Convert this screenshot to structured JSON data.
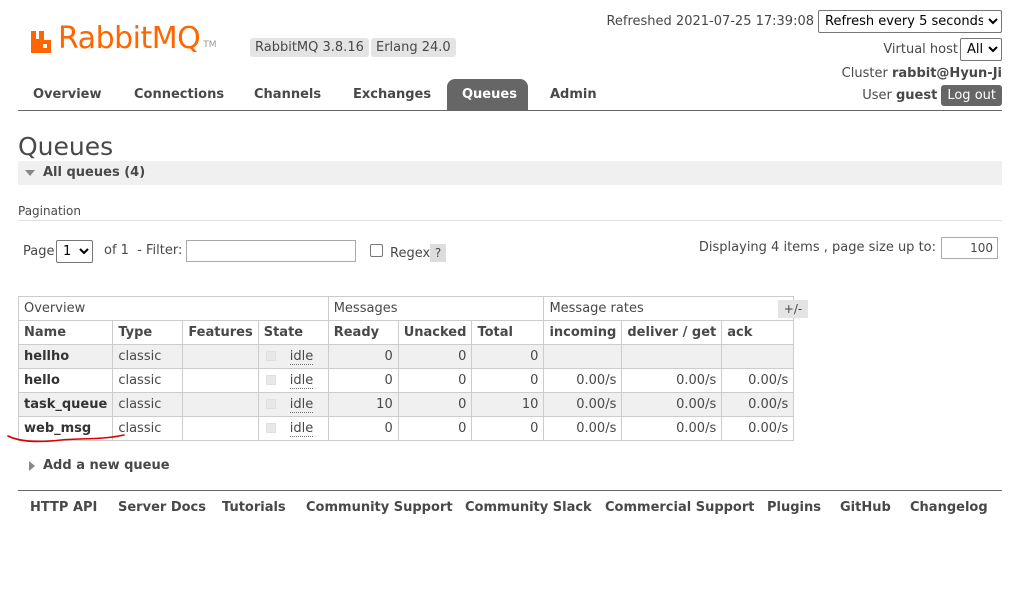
{
  "brand": {
    "logo_text": "RabbitMQ",
    "logo_tm": "TM",
    "rabbitmq_version": "RabbitMQ 3.8.16",
    "erlang_version": "Erlang 24.0",
    "accent_color": "#ff6600"
  },
  "header": {
    "refreshed": "Refreshed 2021-07-25 17:39:08",
    "refresh_option": "Refresh every 5 seconds",
    "vhost_label": "Virtual host",
    "vhost_value": "All",
    "cluster_label": "Cluster",
    "cluster_value": "rabbit@Hyun-Ji",
    "user_label": "User",
    "user_value": "guest",
    "logout": "Log out"
  },
  "nav": {
    "tabs": [
      "Overview",
      "Connections",
      "Channels",
      "Exchanges",
      "Queues",
      "Admin"
    ],
    "active": "Queues"
  },
  "page": {
    "title": "Queues",
    "section": "All queues (4)",
    "pagination_label": "Pagination",
    "page_label": "Page",
    "page_value": "1",
    "of_label": "of 1",
    "filter_label": "- Filter:",
    "filter_value": "",
    "regex_label": "Regex",
    "help": "?",
    "displaying": "Displaying 4 items , page size up to:",
    "page_size": "100",
    "toggle_columns": "+/-",
    "add_queue": "Add a new queue"
  },
  "table": {
    "groups": [
      "Overview",
      "Messages",
      "Message rates"
    ],
    "columns": [
      "Name",
      "Type",
      "Features",
      "State",
      "Ready",
      "Unacked",
      "Total",
      "incoming",
      "deliver / get",
      "ack"
    ],
    "rows": [
      {
        "name": "hellho",
        "type": "classic",
        "features": "",
        "state": "idle",
        "ready": "0",
        "unacked": "0",
        "total": "0",
        "incoming": "",
        "deliver": "",
        "ack": ""
      },
      {
        "name": "hello",
        "type": "classic",
        "features": "",
        "state": "idle",
        "ready": "0",
        "unacked": "0",
        "total": "0",
        "incoming": "0.00/s",
        "deliver": "0.00/s",
        "ack": "0.00/s"
      },
      {
        "name": "task_queue",
        "type": "classic",
        "features": "",
        "state": "idle",
        "ready": "10",
        "unacked": "0",
        "total": "10",
        "incoming": "0.00/s",
        "deliver": "0.00/s",
        "ack": "0.00/s"
      },
      {
        "name": "web_msg",
        "type": "classic",
        "features": "",
        "state": "idle",
        "ready": "0",
        "unacked": "0",
        "total": "0",
        "incoming": "0.00/s",
        "deliver": "0.00/s",
        "ack": "0.00/s"
      }
    ]
  },
  "annotation": {
    "color": "#dd0000"
  },
  "footer": {
    "links": [
      "HTTP API",
      "Server Docs",
      "Tutorials",
      "Community Support",
      "Community Slack",
      "Commercial Support",
      "Plugins",
      "GitHub",
      "Changelog"
    ]
  }
}
